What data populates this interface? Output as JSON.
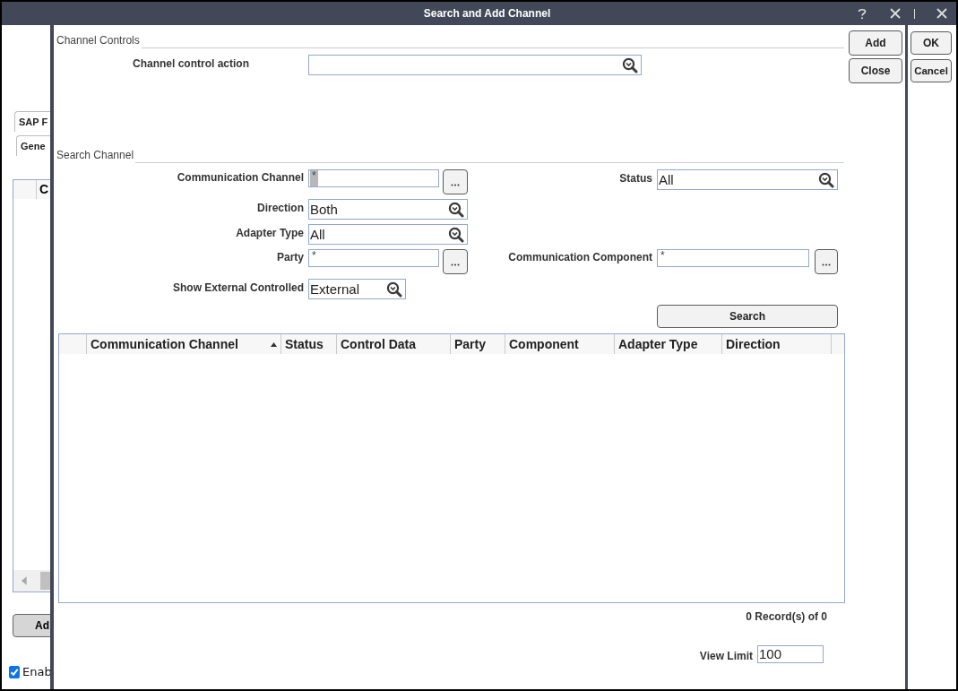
{
  "window": {
    "title": "Search and Add Channel"
  },
  "background": {
    "tabs": [
      {
        "label": "SAP F"
      },
      {
        "label": "Gene"
      }
    ],
    "table": {
      "columns": [
        "C"
      ]
    },
    "add_button": "Ad",
    "checkbox": {
      "label": "Enab",
      "checked": true
    },
    "buttons": [
      "OK",
      "Cancel"
    ]
  },
  "dialog": {
    "channel_controls": {
      "title": "Channel Controls",
      "action_label": "Channel control action"
    },
    "side_buttons": [
      "Add",
      "Close"
    ],
    "search_channel": {
      "title": "Search Channel",
      "rows": [
        {
          "left": {
            "label": "Communication Channel",
            "kind": "text",
            "value": "*",
            "selected": true
          },
          "right": {
            "label": "Status",
            "kind": "combo",
            "value": "All"
          }
        },
        {
          "left": {
            "label": "Direction",
            "kind": "combo",
            "value": "Both"
          }
        },
        {
          "left": {
            "label": "Adapter Type",
            "kind": "combo",
            "value": "All"
          }
        },
        {
          "left": {
            "label": "Party",
            "kind": "text",
            "value": "*",
            "selected": false
          },
          "right": {
            "label": "Communication Component",
            "kind": "text",
            "value": "*",
            "selected": false
          }
        },
        {
          "left": {
            "label": "Show External Controlled",
            "kind": "short-combo",
            "value": "External"
          }
        }
      ],
      "search_button": "Search"
    },
    "results": {
      "columns": [
        {
          "label": "Communication Channel",
          "sorted": true
        },
        {
          "label": "Status",
          "sorted": false
        },
        {
          "label": "Control Data",
          "sorted": false
        },
        {
          "label": "Party",
          "sorted": false
        },
        {
          "label": "Component",
          "sorted": false
        },
        {
          "label": "Adapter Type",
          "sorted": false
        },
        {
          "label": "Direction",
          "sorted": false
        }
      ],
      "record_count": "0 Record(s) of 0",
      "view_limit": {
        "label": "View Limit",
        "value": "100"
      }
    }
  }
}
